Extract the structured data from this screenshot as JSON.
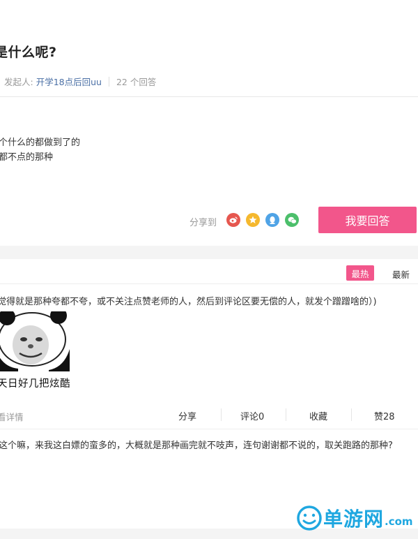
{
  "question": {
    "title": "是什么呢?",
    "initiator_label": "发起人:",
    "initiator_name": "开学18点后回uu",
    "answers_count": "22 个回答",
    "body_lines": [
      "个什么的都做到了的",
      "都不点的那种"
    ]
  },
  "share": {
    "label": "分享到",
    "icons": [
      "weibo-icon",
      "qzone-icon",
      "qq-icon",
      "wechat-icon"
    ],
    "colors": [
      "#e6574f",
      "#f5b82e",
      "#4fa3e6",
      "#4cbf6b"
    ]
  },
  "answer_button": {
    "label": "我要回答",
    "color": "#f2568b"
  },
  "sort": {
    "hot_label": "最热",
    "new_label": "最新"
  },
  "answers": [
    {
      "text": "觉得就是那种夸都不夸，或不关注点赞老师的人，然后到评论区要无偿的人，就发个蹭蹭啥的）)",
      "image_caption": "天日好几把炫酷",
      "detail_link": "看详情",
      "actions": {
        "share": "分享",
        "comment": "评论0",
        "favorite": "收藏",
        "like": "赞28"
      }
    },
    {
      "text": "这个嘛，来我这白嫖的蛮多的，大概就是那种画完就不吱声，连句谢谢都不说的，取关跑路的那种?"
    }
  ],
  "watermark": {
    "text": "单游网",
    "suffix": ".com"
  }
}
